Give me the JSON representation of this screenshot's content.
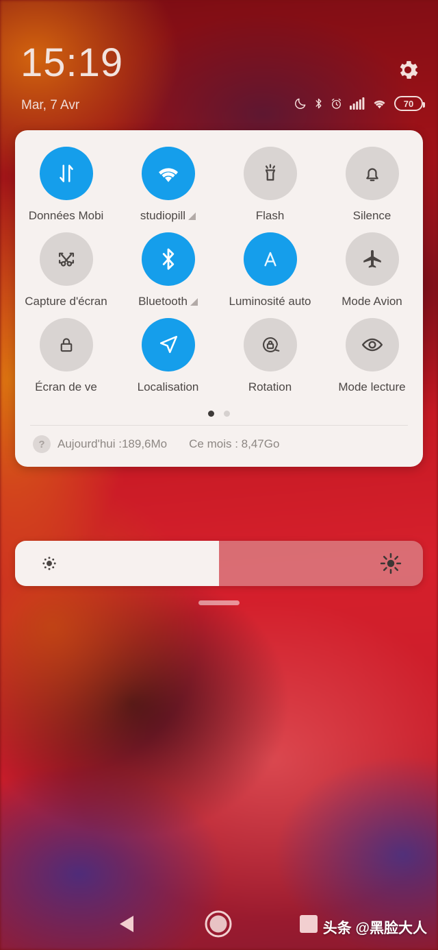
{
  "statusbar": {
    "clock": "15:19",
    "date": "Mar, 7 Avr",
    "battery_level": "70",
    "icons": [
      "moon-dnd-icon",
      "bluetooth-icon",
      "alarm-icon",
      "signal-bars-icon",
      "wifi-icon",
      "battery-icon"
    ],
    "settings_icon": "gear-icon"
  },
  "quick_settings": {
    "accent_color": "#159eeb",
    "inactive_color": "#d9d4d2",
    "panel_color": "#f6f1ef",
    "tiles": [
      {
        "label": "Données Mobi",
        "icon": "mobile-data-icon",
        "active": true,
        "expandable": false,
        "clipped": true
      },
      {
        "label": "studiopill",
        "icon": "wifi-icon",
        "active": true,
        "expandable": true,
        "clipped": false
      },
      {
        "label": "Flash",
        "icon": "flashlight-icon",
        "active": false,
        "expandable": false,
        "clipped": false
      },
      {
        "label": "Silence",
        "icon": "bell-icon",
        "active": false,
        "expandable": false,
        "clipped": false
      },
      {
        "label": "Capture d'écran",
        "icon": "screenshot-icon",
        "active": false,
        "expandable": false,
        "clipped": false
      },
      {
        "label": "Bluetooth",
        "icon": "bluetooth-icon",
        "active": true,
        "expandable": true,
        "clipped": false
      },
      {
        "label": "Luminosité auto",
        "icon": "auto-brightness-icon",
        "active": true,
        "expandable": false,
        "clipped": false
      },
      {
        "label": "Mode Avion",
        "icon": "airplane-icon",
        "active": false,
        "expandable": false,
        "clipped": false
      },
      {
        "label": "Écran de ve",
        "icon": "lock-icon",
        "active": false,
        "expandable": false,
        "clipped": true
      },
      {
        "label": "Localisation",
        "icon": "location-arrow-icon",
        "active": true,
        "expandable": false,
        "clipped": false
      },
      {
        "label": "Rotation",
        "icon": "rotation-lock-icon",
        "active": false,
        "expandable": false,
        "clipped": false
      },
      {
        "label": "Mode lecture",
        "icon": "eye-icon",
        "active": false,
        "expandable": false,
        "clipped": false
      }
    ],
    "pages": {
      "count": 2,
      "current": 1
    },
    "data_usage": {
      "help_icon": "question-mark-icon",
      "today": "Aujourd'hui :189,6Mo",
      "month": "Ce mois : 8,47Go"
    }
  },
  "brightness": {
    "value_percent": 50,
    "low_icon": "brightness-low-icon",
    "high_icon": "brightness-high-icon"
  },
  "navbar": {
    "back": "back-triangle-icon",
    "home": "home-circle-icon",
    "recent": "recent-square-icon",
    "watermark": "头条 @黑脸大人"
  }
}
